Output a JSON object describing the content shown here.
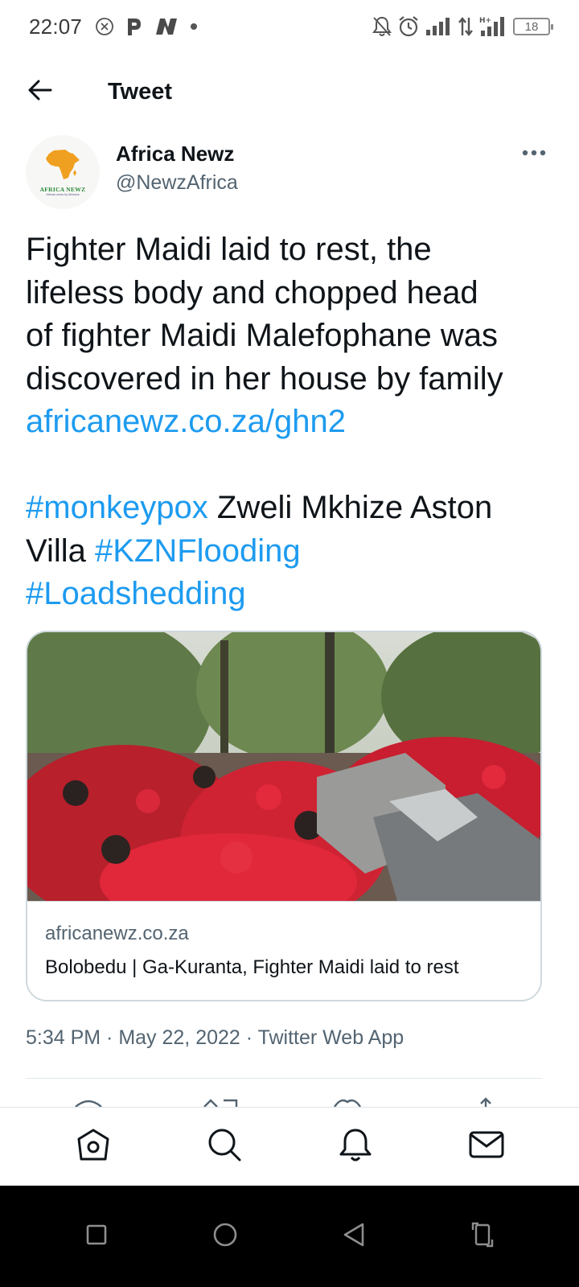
{
  "status_bar": {
    "time": "22:07",
    "battery": "18"
  },
  "header": {
    "title": "Tweet"
  },
  "tweet": {
    "author_name": "Africa Newz",
    "author_handle": "@NewzAfrica",
    "avatar_word": "AFRICA NEWZ",
    "avatar_sub": "African news by Africans",
    "text_lines": [
      "Fighter Maidi laid to rest, the",
      "lifeless body and chopped head",
      "of fighter Maidi Malefophane was",
      "discovered in her house by family"
    ],
    "link": "africanewz.co.za/ghn2",
    "hashtag_1": "#monkeypox",
    "text_after_hashtag_1": " Zweli Mkhize Aston",
    "text_villa": "Villa ",
    "hashtag_2": "#KZNFlooding",
    "hashtag_3": "#Loadshedding",
    "card": {
      "domain": "africanewz.co.za",
      "title": "Bolobedu | Ga-Kuranta, Fighter Maidi laid to rest"
    },
    "timestamp": "5:34 PM · May 22, 2022 · Twitter Web App"
  },
  "colors": {
    "link": "#1d9bf0",
    "text": "#0f1419",
    "muted": "#536471",
    "border": "#cfd9de",
    "logo_orange": "#f0a020",
    "logo_green": "#2a8a3a"
  },
  "icons": {
    "back": "arrow-left-icon",
    "more": "more-horizontal-icon",
    "nav": [
      "home-icon",
      "search-icon",
      "notifications-icon",
      "messages-icon"
    ],
    "system": [
      "recents-icon",
      "home-circle-icon",
      "back-triangle-icon",
      "rotate-icon"
    ]
  }
}
